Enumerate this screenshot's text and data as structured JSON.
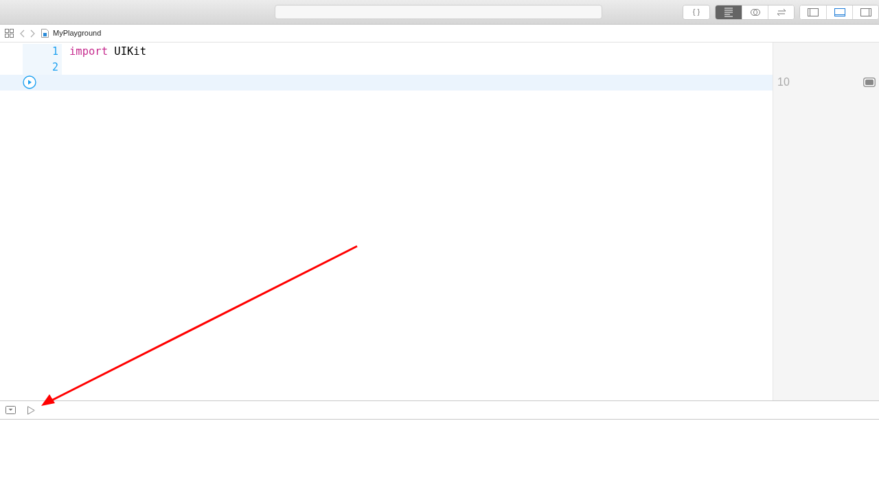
{
  "toolbar": {
    "groups": [
      {
        "buttons": [
          {
            "kind": "braces",
            "label": "{ }",
            "selected": false
          }
        ]
      },
      {
        "buttons": [
          {
            "kind": "lines",
            "selected": true
          },
          {
            "kind": "circles",
            "selected": false
          },
          {
            "kind": "arrows",
            "selected": false
          }
        ]
      },
      {
        "buttons": [
          {
            "kind": "left",
            "selected": false
          },
          {
            "kind": "bottom",
            "selected": true
          },
          {
            "kind": "right",
            "selected": false
          }
        ]
      }
    ]
  },
  "jump_bar": {
    "file": "MyPlayground"
  },
  "editor": {
    "lines": [
      {
        "kind": "number",
        "number": "1",
        "current": false,
        "tokens": [
          {
            "text": "import",
            "kind": "keyword"
          },
          {
            "text": " UIKit",
            "kind": "plain"
          }
        ]
      },
      {
        "kind": "number",
        "number": "2",
        "current": false
      },
      {
        "kind": "run",
        "current": true,
        "result": "10"
      }
    ]
  },
  "annotation": {
    "kind": "arrow"
  }
}
